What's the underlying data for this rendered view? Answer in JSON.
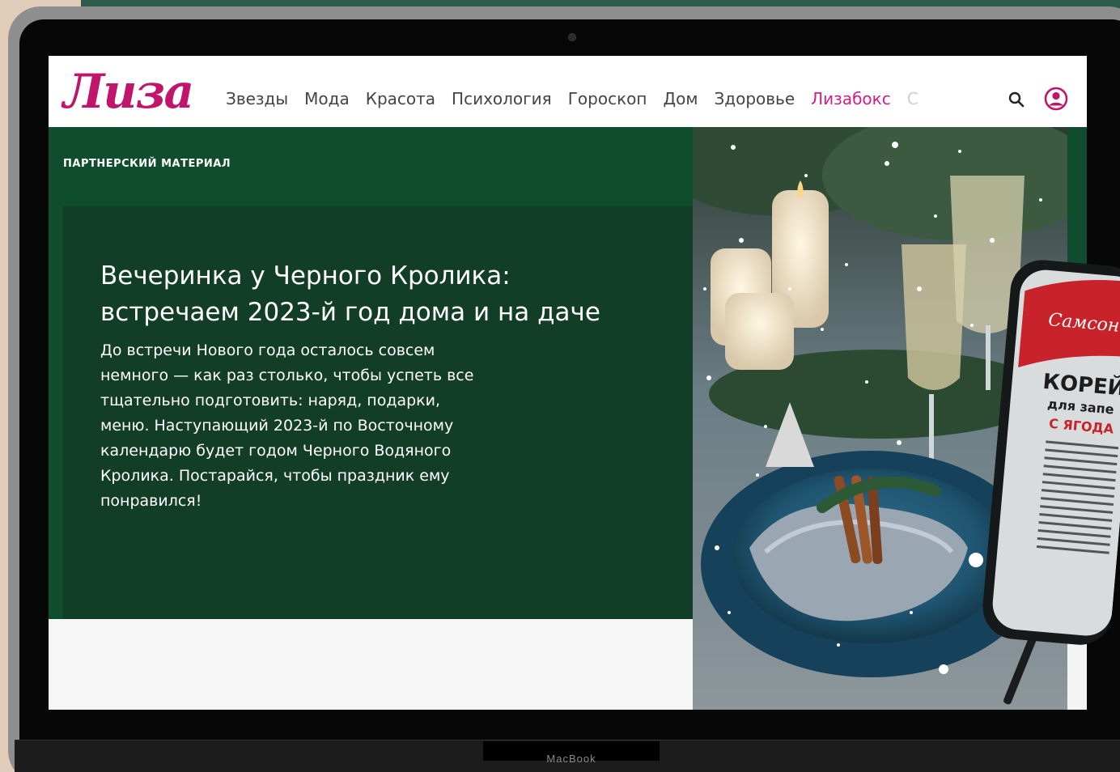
{
  "site": {
    "logo": "Лиза",
    "nav": [
      "Звезды",
      "Мода",
      "Красота",
      "Психология",
      "Гороскоп",
      "Дом",
      "Здоровье",
      "Лизабокс",
      "С"
    ],
    "active_nav": "Лизабокс"
  },
  "hero": {
    "label": "ПАРТНЕРСКИЙ МАТЕРИАЛ",
    "title_line1": "Вечеринка у Черного Кролика:",
    "title_line2": "встречаем 2023-й год дома и на даче",
    "text": "До встречи Нового года осталось совсем немного — как раз столько, чтобы успеть все тщательно подготовить: наряд, подарки, меню. Наступающий 2023-й по Восточному календарю будет годом Черного Водяного Кролика. Постарайся, чтобы праздник ему понравился!"
  },
  "package": {
    "brand": "Самсон",
    "title": "КОРЕЙ",
    "subtitle": "для запе",
    "note": "С ЯГОДА"
  },
  "device": {
    "label": "MacBook"
  },
  "colors": {
    "brand": "#c0156a",
    "accent": "#d21d83",
    "hero_bg": "#0f4d2e",
    "card_bg": "#123d26"
  },
  "icons": [
    "search-icon",
    "user-icon",
    "camera-icon"
  ]
}
